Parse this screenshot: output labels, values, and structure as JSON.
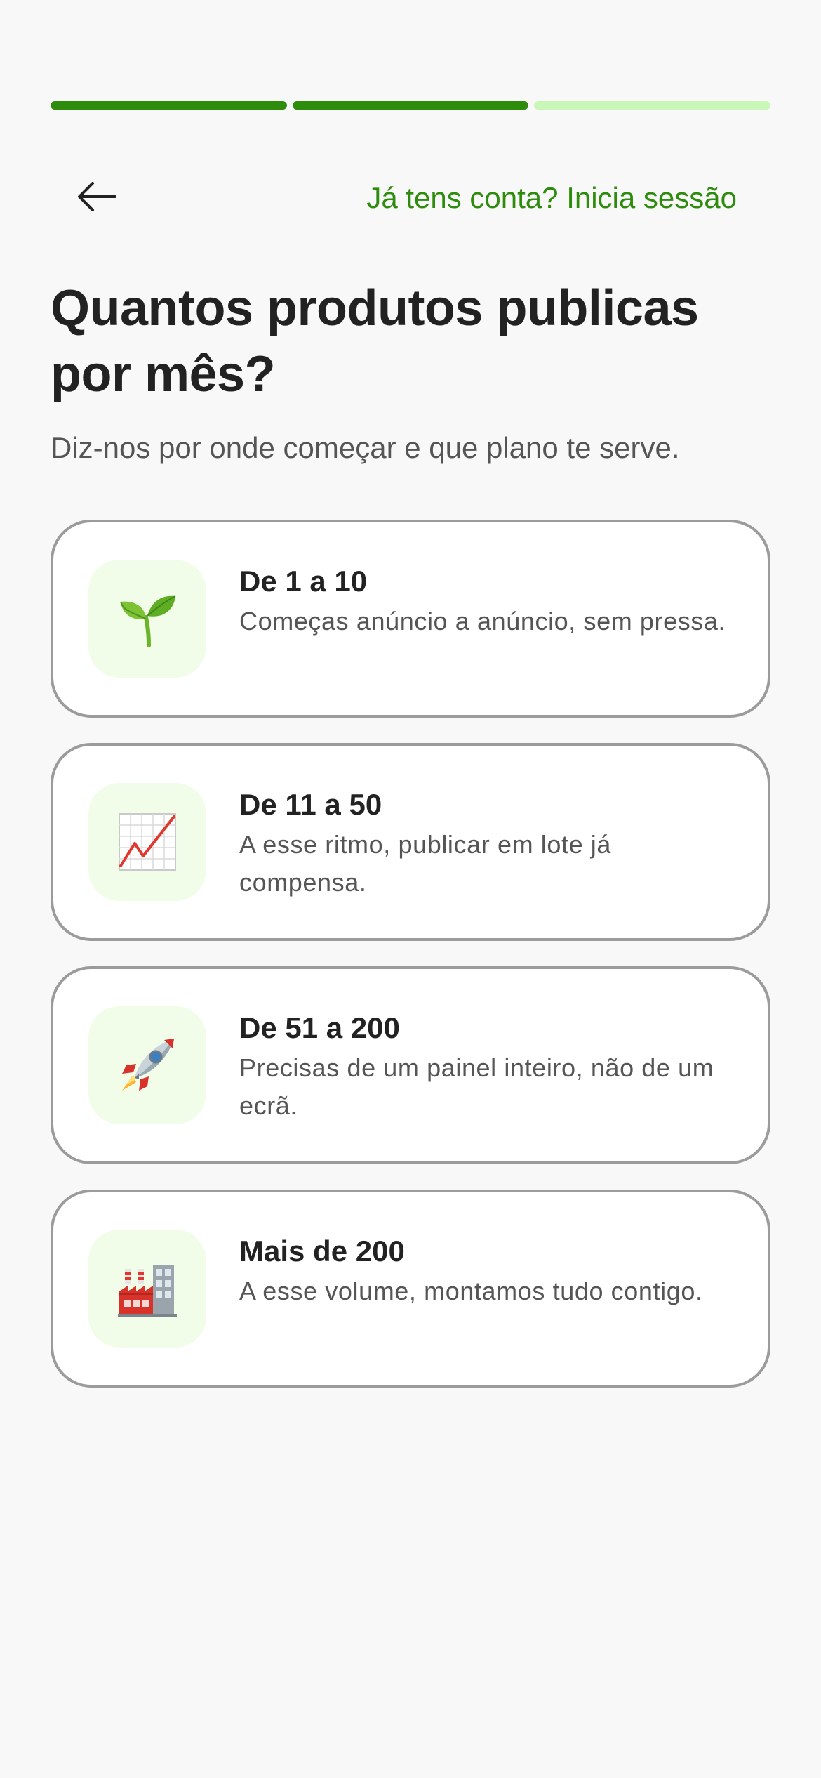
{
  "progress": {
    "steps_total": 3,
    "steps_completed": 2,
    "colors": {
      "done": "#2e8c0d",
      "pending": "#c8f7b8"
    }
  },
  "header": {
    "back_icon": "arrow-left-icon",
    "login_link": "Já tens conta? Inicia sessão"
  },
  "title": "Quantos produtos publicas por mês?",
  "subtitle": "Diz-nos por onde começar e que plano te serve.",
  "options": [
    {
      "icon": "seedling-icon",
      "label": "De 1 a 10",
      "description": "Começas anúncio a anúncio, sem pressa."
    },
    {
      "icon": "chart-increasing-icon",
      "label": "De 11 a 50",
      "description": "A esse ritmo, publicar em lote já compensa."
    },
    {
      "icon": "rocket-icon",
      "label": "De 51 a 200",
      "description": "Precisas de um painel inteiro, não de um ecrã."
    },
    {
      "icon": "factory-icon",
      "label": "Mais de 200",
      "description": "A esse volume, montamos tudo contigo."
    }
  ],
  "colors": {
    "accent": "#2e8c0d",
    "background": "#f8f8f8",
    "card_border": "#9b9b9b",
    "icon_bg": "#f1fde9",
    "text": "#222222",
    "muted_text": "#555555"
  }
}
